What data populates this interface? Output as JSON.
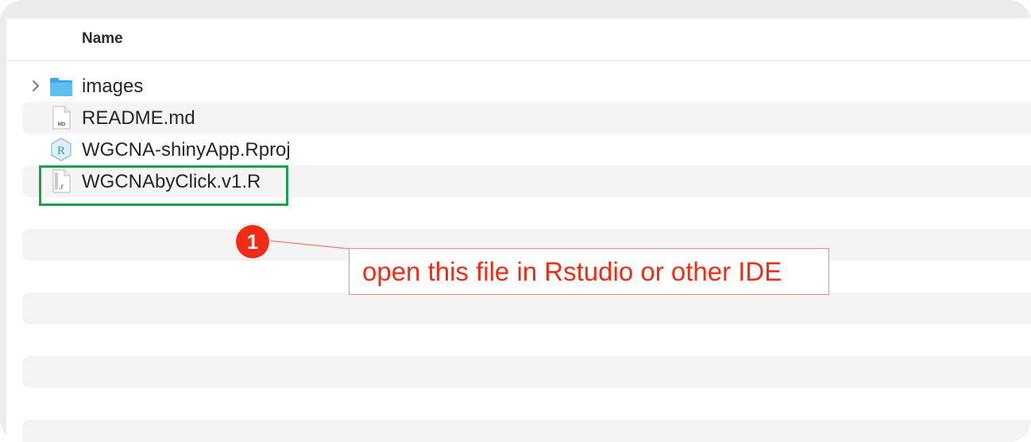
{
  "file_list": {
    "column_header": "Name",
    "items": [
      {
        "name": "images",
        "icon": "folder-icon",
        "expandable": true
      },
      {
        "name": "README.md",
        "icon": "markdown-file-icon",
        "expandable": false
      },
      {
        "name": "WGCNA-shinyApp.Rproj",
        "icon": "rproj-file-icon",
        "expandable": false
      },
      {
        "name": "WGCNAbyClick.v1.R",
        "icon": "r-script-file-icon",
        "expandable": false
      }
    ]
  },
  "annotation": {
    "step_number": "1",
    "callout_text": "open this file in Rstudio or other IDE",
    "highlight_color": "#1aa04a",
    "badge_color": "#f22b14",
    "text_color": "#f22b14",
    "callout_border_color": "#f08a80"
  },
  "icon_labels": {
    "markdown": "MD",
    "rproj": "R",
    "rscript": ".r"
  }
}
